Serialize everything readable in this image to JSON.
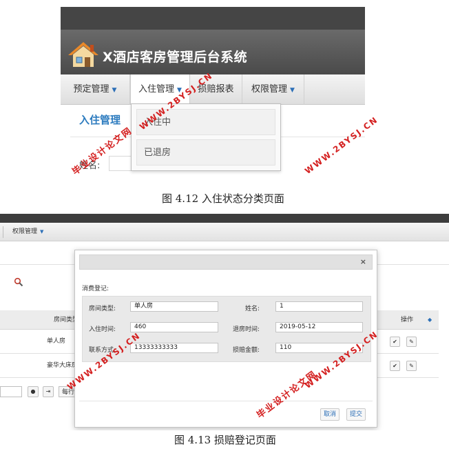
{
  "figure1": {
    "app_title": "X酒店客房管理后台系统",
    "nav": [
      {
        "label": "预定管理"
      },
      {
        "label": "入住管理"
      },
      {
        "label": "损赔报表"
      },
      {
        "label": "权限管理"
      }
    ],
    "section_title": "入住管理",
    "dropdown_items": [
      "入住中",
      "已退房"
    ],
    "name_label": "姓名:",
    "caption": "图 4.12  入住状态分类页面"
  },
  "figure2": {
    "nav_item": "权限管理",
    "table_headers": {
      "room_type": "房间类型",
      "operation": "操作"
    },
    "rows": [
      {
        "room_type": "单人房"
      },
      {
        "room_type": "豪华大床房"
      }
    ],
    "per_page": "每行",
    "modal": {
      "title": "消费登记:",
      "close": "×",
      "fields": {
        "room_type_label": "房间类型:",
        "room_type_value": "单人房",
        "name_label": "姓名:",
        "name_value": "1",
        "checkin_label": "入住时间:",
        "checkin_value": "460",
        "checkout_label": "退房时间:",
        "checkout_value": "2019-05-12",
        "contact_label": "联系方式:",
        "contact_value": "13333333333",
        "damage_label": "损赔金额:",
        "damage_value": "110"
      },
      "cancel": "取消",
      "submit": "提交"
    },
    "caption": "图 4.13  损赔登记页面"
  },
  "watermarks": {
    "site": "WWW.2BYSJ.CN",
    "text": "毕业设计论文网"
  },
  "colors": {
    "accent": "#2c6fb7",
    "watermark": "#d42020",
    "header_dark": "#454545"
  }
}
